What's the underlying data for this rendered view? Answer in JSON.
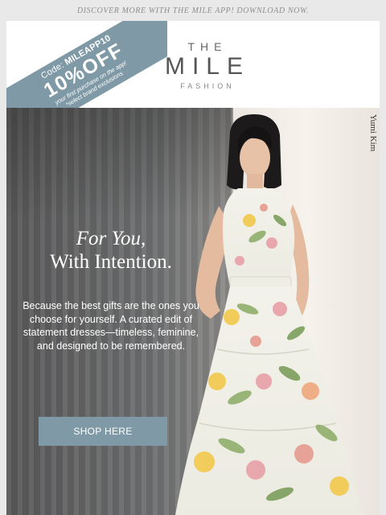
{
  "top_banner": {
    "text": "DISCOVER MORE WITH THE MILE APP! DOWNLOAD NOW."
  },
  "promo_ribbon": {
    "code_prefix": "Code:",
    "code": "MILEAPP10",
    "offer": "10%OFF",
    "line1": "your first purchase on the app!",
    "line2": "*select brand exclusions"
  },
  "logo": {
    "line1": "THE",
    "line2": "MILE",
    "line3": "FASHION"
  },
  "hero": {
    "photographer": "Yumi Kim",
    "headline_line1": "For You,",
    "headline_line2": "With Intention.",
    "body": "Because the best gifts are the ones you choose for yourself. A curated edit of statement dresses—timeless, feminine, and designed to be remembered.",
    "cta_label": "SHOP HERE"
  },
  "colors": {
    "accent": "#7f9aa6",
    "page_bg": "#e9e9e9"
  }
}
